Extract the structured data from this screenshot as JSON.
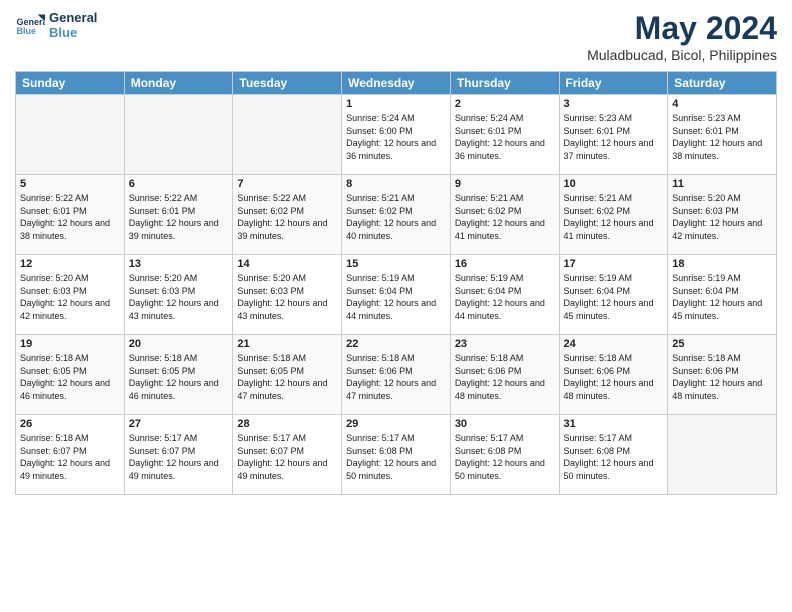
{
  "header": {
    "title": "May 2024",
    "location": "Muladbucad, Bicol, Philippines"
  },
  "days": [
    "Sunday",
    "Monday",
    "Tuesday",
    "Wednesday",
    "Thursday",
    "Friday",
    "Saturday"
  ],
  "weeks": [
    [
      {
        "day": "",
        "empty": true
      },
      {
        "day": "",
        "empty": true
      },
      {
        "day": "",
        "empty": true
      },
      {
        "day": "1",
        "sun": "5:24 AM",
        "set": "6:00 PM",
        "hours": "12 hours and 36 minutes."
      },
      {
        "day": "2",
        "sun": "5:24 AM",
        "set": "6:01 PM",
        "hours": "12 hours and 36 minutes."
      },
      {
        "day": "3",
        "sun": "5:23 AM",
        "set": "6:01 PM",
        "hours": "12 hours and 37 minutes."
      },
      {
        "day": "4",
        "sun": "5:23 AM",
        "set": "6:01 PM",
        "hours": "12 hours and 38 minutes."
      }
    ],
    [
      {
        "day": "5",
        "sun": "5:22 AM",
        "set": "6:01 PM",
        "hours": "12 hours and 38 minutes."
      },
      {
        "day": "6",
        "sun": "5:22 AM",
        "set": "6:01 PM",
        "hours": "12 hours and 39 minutes."
      },
      {
        "day": "7",
        "sun": "5:22 AM",
        "set": "6:02 PM",
        "hours": "12 hours and 39 minutes."
      },
      {
        "day": "8",
        "sun": "5:21 AM",
        "set": "6:02 PM",
        "hours": "12 hours and 40 minutes."
      },
      {
        "day": "9",
        "sun": "5:21 AM",
        "set": "6:02 PM",
        "hours": "12 hours and 41 minutes."
      },
      {
        "day": "10",
        "sun": "5:21 AM",
        "set": "6:02 PM",
        "hours": "12 hours and 41 minutes."
      },
      {
        "day": "11",
        "sun": "5:20 AM",
        "set": "6:03 PM",
        "hours": "12 hours and 42 minutes."
      }
    ],
    [
      {
        "day": "12",
        "sun": "5:20 AM",
        "set": "6:03 PM",
        "hours": "12 hours and 42 minutes."
      },
      {
        "day": "13",
        "sun": "5:20 AM",
        "set": "6:03 PM",
        "hours": "12 hours and 43 minutes."
      },
      {
        "day": "14",
        "sun": "5:20 AM",
        "set": "6:03 PM",
        "hours": "12 hours and 43 minutes."
      },
      {
        "day": "15",
        "sun": "5:19 AM",
        "set": "6:04 PM",
        "hours": "12 hours and 44 minutes."
      },
      {
        "day": "16",
        "sun": "5:19 AM",
        "set": "6:04 PM",
        "hours": "12 hours and 44 minutes."
      },
      {
        "day": "17",
        "sun": "5:19 AM",
        "set": "6:04 PM",
        "hours": "12 hours and 45 minutes."
      },
      {
        "day": "18",
        "sun": "5:19 AM",
        "set": "6:04 PM",
        "hours": "12 hours and 45 minutes."
      }
    ],
    [
      {
        "day": "19",
        "sun": "5:18 AM",
        "set": "6:05 PM",
        "hours": "12 hours and 46 minutes."
      },
      {
        "day": "20",
        "sun": "5:18 AM",
        "set": "6:05 PM",
        "hours": "12 hours and 46 minutes."
      },
      {
        "day": "21",
        "sun": "5:18 AM",
        "set": "6:05 PM",
        "hours": "12 hours and 47 minutes."
      },
      {
        "day": "22",
        "sun": "5:18 AM",
        "set": "6:06 PM",
        "hours": "12 hours and 47 minutes."
      },
      {
        "day": "23",
        "sun": "5:18 AM",
        "set": "6:06 PM",
        "hours": "12 hours and 48 minutes."
      },
      {
        "day": "24",
        "sun": "5:18 AM",
        "set": "6:06 PM",
        "hours": "12 hours and 48 minutes."
      },
      {
        "day": "25",
        "sun": "5:18 AM",
        "set": "6:06 PM",
        "hours": "12 hours and 48 minutes."
      }
    ],
    [
      {
        "day": "26",
        "sun": "5:18 AM",
        "set": "6:07 PM",
        "hours": "12 hours and 49 minutes."
      },
      {
        "day": "27",
        "sun": "5:17 AM",
        "set": "6:07 PM",
        "hours": "12 hours and 49 minutes."
      },
      {
        "day": "28",
        "sun": "5:17 AM",
        "set": "6:07 PM",
        "hours": "12 hours and 49 minutes."
      },
      {
        "day": "29",
        "sun": "5:17 AM",
        "set": "6:08 PM",
        "hours": "12 hours and 50 minutes."
      },
      {
        "day": "30",
        "sun": "5:17 AM",
        "set": "6:08 PM",
        "hours": "12 hours and 50 minutes."
      },
      {
        "day": "31",
        "sun": "5:17 AM",
        "set": "6:08 PM",
        "hours": "12 hours and 50 minutes."
      },
      {
        "day": "",
        "empty": true
      }
    ]
  ]
}
